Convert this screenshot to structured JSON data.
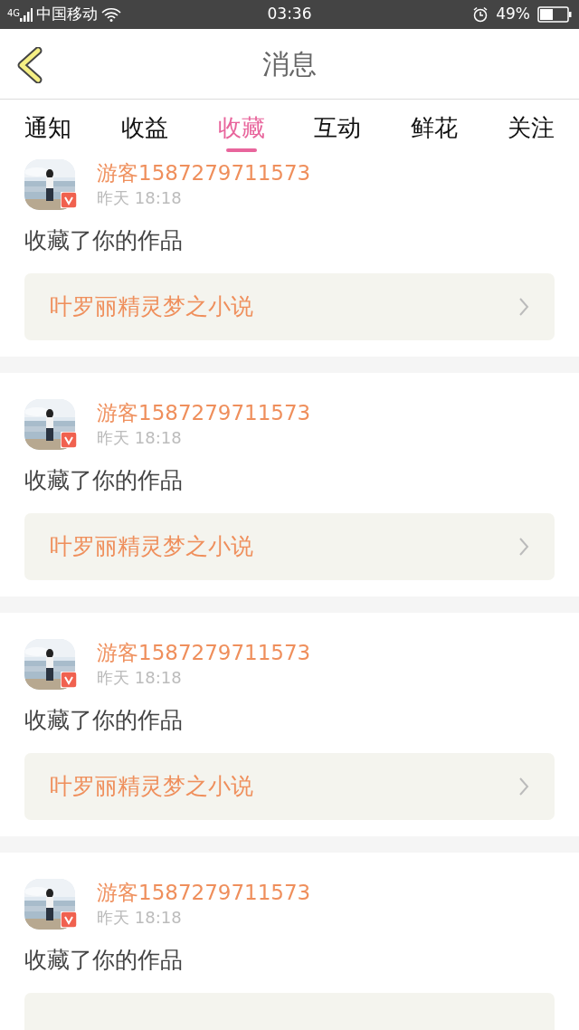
{
  "status_bar": {
    "network": "4G",
    "carrier": "中国移动",
    "time": "03:36",
    "battery": "49%"
  },
  "header": {
    "title": "消息"
  },
  "tabs": [
    {
      "label": "通知",
      "selected": false
    },
    {
      "label": "收益",
      "selected": false
    },
    {
      "label": "收藏",
      "selected": true
    },
    {
      "label": "互动",
      "selected": false
    },
    {
      "label": "鲜花",
      "selected": false
    },
    {
      "label": "关注",
      "selected": false
    }
  ],
  "messages": [
    {
      "user": "游客1587279711573",
      "time": "昨天 18:18",
      "action": "收藏了你的作品",
      "work": "叶罗丽精灵梦之小说"
    },
    {
      "user": "游客1587279711573",
      "time": "昨天 18:18",
      "action": "收藏了你的作品",
      "work": "叶罗丽精灵梦之小说"
    },
    {
      "user": "游客1587279711573",
      "time": "昨天 18:18",
      "action": "收藏了你的作品",
      "work": "叶罗丽精灵梦之小说"
    },
    {
      "user": "游客1587279711573",
      "time": "昨天 18:18",
      "action": "收藏了你的作品"
    }
  ]
}
